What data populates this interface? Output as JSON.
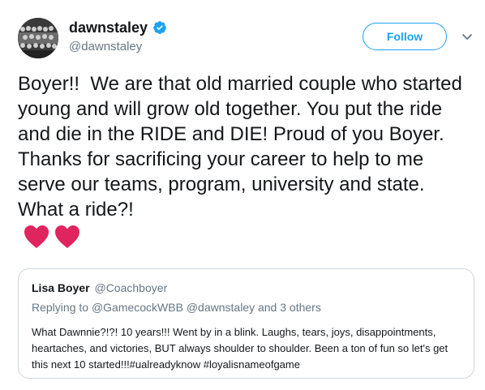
{
  "author": {
    "name": "dawnstaley",
    "handle": "@dawnstaley",
    "verified": true,
    "avatar_icon": "team-photo-avatar"
  },
  "actions": {
    "follow_label": "Follow",
    "more_icon": "chevron-down-icon"
  },
  "tweet": {
    "text": "Boyer!!  We are that old married couple who started young and will grow old together. You put the ride and die in the RIDE and DIE! Proud of you Boyer. Thanks for sacrificing your career to help to me serve our teams, program, university and state. What a ride?!",
    "emoji": [
      "heart-icon",
      "heart-icon"
    ]
  },
  "quoted_tweet": {
    "name": "Lisa Boyer",
    "handle": "@Coachboyer",
    "replying_prefix": "Replying to",
    "replying_mentions": "@GamecockWBB @dawnstaley",
    "replying_suffix": "and 3 others",
    "text": "What Dawnnie?!?!  10 years!!!  Went by in a blink. Laughs, tears, joys, disappointments, heartaches, and victories, BUT always shoulder to shoulder.  Been a ton of fun so let's get this next 10 started!!!#ualreadyknow #loyalisnameofgame"
  },
  "colors": {
    "accent": "#1da1f2",
    "secondary_text": "#657786",
    "border": "#ccd6dd",
    "heart": "#e0245e"
  }
}
